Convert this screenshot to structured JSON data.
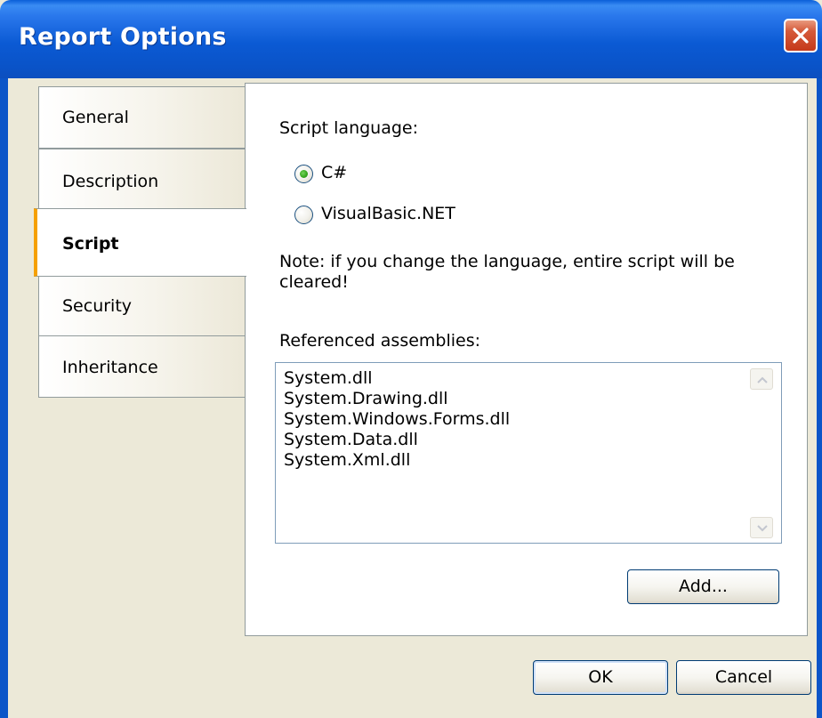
{
  "window": {
    "title": "Report Options"
  },
  "tabs": [
    {
      "label": "General"
    },
    {
      "label": "Description"
    },
    {
      "label": "Script"
    },
    {
      "label": "Security"
    },
    {
      "label": "Inheritance"
    }
  ],
  "active_tab": "Script",
  "script": {
    "language_label": "Script language:",
    "options": [
      {
        "label": "C#",
        "selected": true
      },
      {
        "label": "VisualBasic.NET",
        "selected": false
      }
    ],
    "note_line1": "Note: if you change the language, entire script will be",
    "note_line2": "cleared!",
    "assemblies_label": "Referenced assemblies:",
    "assemblies": [
      "System.dll",
      "System.Drawing.dll",
      "System.Windows.Forms.dll",
      "System.Data.dll",
      "System.Xml.dll"
    ],
    "add_button": "Add..."
  },
  "footer": {
    "ok_button": "OK",
    "cancel_button": "Cancel"
  },
  "colors": {
    "titlebar": "#0a53c8",
    "dialog_bg": "#ece9d8",
    "active_tab_accent": "#f6a000"
  }
}
